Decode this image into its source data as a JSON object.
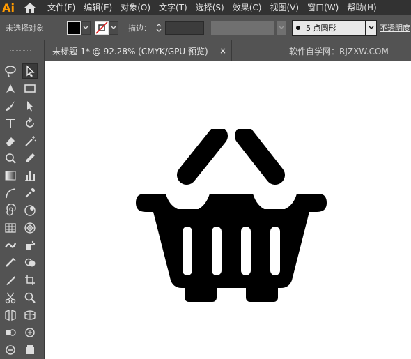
{
  "app": {
    "logo": "Ai",
    "menu": [
      "文件(F)",
      "编辑(E)",
      "对象(O)",
      "文字(T)",
      "选择(S)",
      "效果(C)",
      "视图(V)",
      "窗口(W)",
      "帮助(H)"
    ]
  },
  "control": {
    "selection_status": "未选择对象",
    "stroke_label": "描边：",
    "brush_value": "5 点圆形",
    "opacity_label": "不透明度",
    "fill_color": "#000000",
    "stroke_color": "#ffffff"
  },
  "document": {
    "tab_title": "未标题-1* @ 92.28% (CMYK/GPU 预览)",
    "tab_close": "×",
    "watermark": "软件自学网：RJZXW.COM"
  },
  "canvas": {
    "background": "#ffffff",
    "artwork": "basket-icon",
    "artwork_color": "#000000"
  },
  "tools": [
    "lasso-icon",
    "direct-selection-icon",
    "pen-icon",
    "rectangle-icon",
    "paintbrush-icon",
    "pointer-icon",
    "type-icon",
    "rotate-icon",
    "eraser-icon",
    "magic-wand-icon",
    "reshape-icon",
    "pencil-icon",
    "gradient-icon",
    "bar-graph-icon",
    "arc-icon",
    "eyedropper-icon",
    "spiral-icon",
    "blend-icon",
    "grid-icon",
    "polar-grid-icon",
    "blob-brush-icon",
    "symbol-sprayer-icon",
    "scissors-icon",
    "zoom-icon"
  ]
}
